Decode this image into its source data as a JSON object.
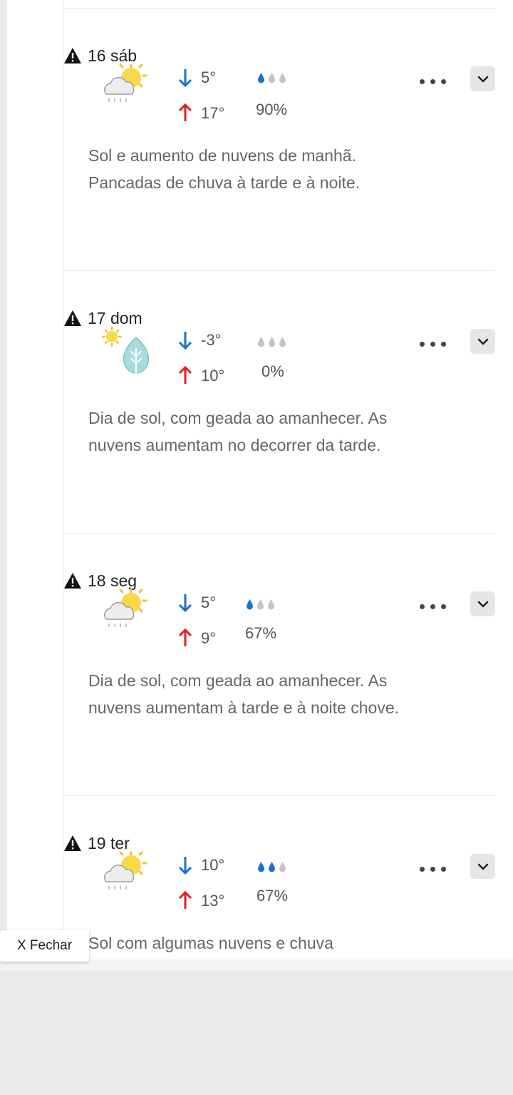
{
  "days": [
    {
      "date": "16 sáb",
      "icon": "sun-cloud-rain-icon",
      "tmin": "5°",
      "tmax": "17°",
      "rain_drops_filled": 1,
      "rain_prob": "90%",
      "description": "Sol e aumento de nuvens de manhã. Pancadas de chuva à tarde e à noite."
    },
    {
      "date": "17 dom",
      "icon": "sun-frost-icon",
      "tmin": "-3°",
      "tmax": "10°",
      "rain_drops_filled": 0,
      "rain_prob": "0%",
      "description": "Dia de sol, com geada ao amanhecer. As nuvens aumentam no decorrer da tarde."
    },
    {
      "date": "18 seg",
      "icon": "sun-cloud-rain-icon",
      "tmin": "5°",
      "tmax": "9°",
      "rain_drops_filled": 1,
      "rain_prob": "67%",
      "description": "Dia de sol, com geada ao amanhecer. As nuvens aumentam à tarde e à noite chove."
    },
    {
      "date": "19 ter",
      "icon": "sun-cloud-rain-icon",
      "tmin": "10°",
      "tmax": "13°",
      "rain_drops_filled": 2,
      "rain_prob": "67%",
      "description": "Sol com algumas nuvens e chuva"
    }
  ],
  "close_label": "X Fechar",
  "colors": {
    "min_arrow": "#1a73c8",
    "max_arrow": "#e02020",
    "drop_filled": "#1a73c8",
    "drop_empty": "#c4c4c4",
    "warning": "#111111"
  }
}
